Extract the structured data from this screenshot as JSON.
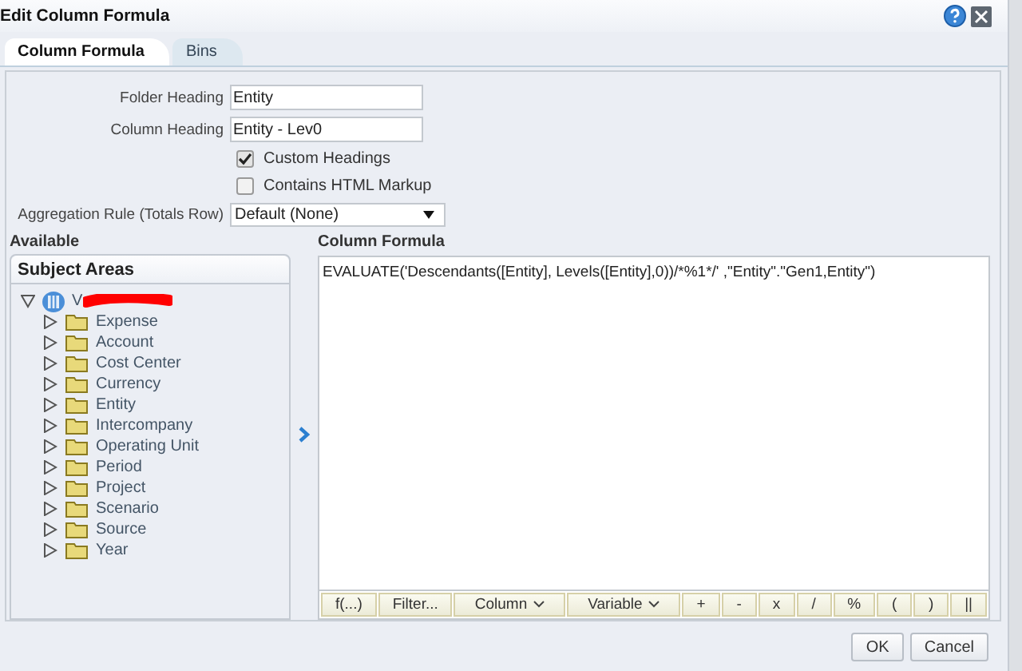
{
  "window": {
    "title": "Edit Column Formula"
  },
  "tabs": [
    {
      "label": "Column Formula",
      "selected": true
    },
    {
      "label": "Bins",
      "selected": false
    }
  ],
  "form": {
    "folder_heading": {
      "label": "Folder Heading",
      "value": "Entity"
    },
    "column_heading": {
      "label": "Column Heading",
      "value": "Entity - Lev0"
    },
    "checkboxes": [
      {
        "label": "Custom Headings",
        "checked": true
      },
      {
        "label": "Contains HTML Markup",
        "checked": false
      }
    ],
    "aggregation": {
      "label": "Aggregation Rule (Totals Row)",
      "value": "Default (None)"
    }
  },
  "available": {
    "heading": "Available",
    "panel_title": "Subject Areas",
    "tree": [
      {
        "label": "V",
        "expanded": true,
        "children": [
          {
            "label": "Expense",
            "expanded": false
          },
          {
            "label": "Account",
            "expanded": false
          },
          {
            "label": "Cost Center",
            "expanded": false
          },
          {
            "label": "Currency",
            "expanded": false
          },
          {
            "label": "Entity",
            "expanded": false
          },
          {
            "label": "Intercompany",
            "expanded": false
          },
          {
            "label": "Operating Unit",
            "expanded": false
          },
          {
            "label": "Period",
            "expanded": false
          },
          {
            "label": "Project",
            "expanded": false
          },
          {
            "label": "Scenario",
            "expanded": false
          },
          {
            "label": "Source",
            "expanded": false
          },
          {
            "label": "Year",
            "expanded": false
          }
        ]
      }
    ]
  },
  "formula": {
    "heading": "Column Formula",
    "value": "EVALUATE('Descendants([Entity], Levels([Entity],0))/*%1*/' ,\"Entity\".\"Gen1,Entity\")",
    "toolbar": [
      {
        "label": "f(...)",
        "kind": "plain"
      },
      {
        "label": "Filter...",
        "kind": "plain"
      },
      {
        "label": "Column",
        "kind": "menu"
      },
      {
        "label": "Variable",
        "kind": "menu"
      },
      {
        "label": "+",
        "kind": "plain"
      },
      {
        "label": "-",
        "kind": "plain"
      },
      {
        "label": "x",
        "kind": "plain"
      },
      {
        "label": "/",
        "kind": "plain"
      },
      {
        "label": "%",
        "kind": "plain"
      },
      {
        "label": "(",
        "kind": "plain"
      },
      {
        "label": ")",
        "kind": "plain"
      },
      {
        "label": "||",
        "kind": "plain"
      }
    ]
  },
  "buttons": [
    "OK",
    "Cancel"
  ]
}
